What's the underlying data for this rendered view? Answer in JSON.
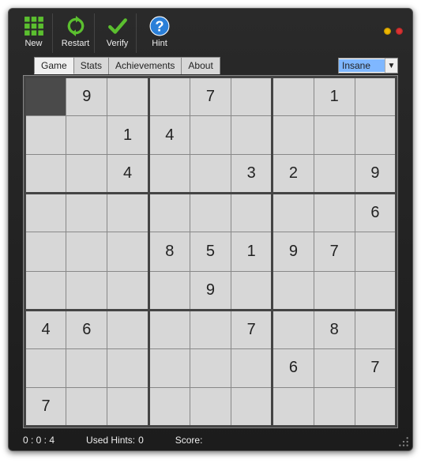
{
  "toolbar": {
    "new_label": "New",
    "restart_label": "Restart",
    "verify_label": "Verify",
    "hint_label": "Hint"
  },
  "tabs": {
    "game": "Game",
    "stats": "Stats",
    "achievements": "Achievements",
    "about": "About"
  },
  "difficulty": {
    "selected": "Insane"
  },
  "sudoku": {
    "selected": [
      0,
      0
    ],
    "grid": [
      [
        "",
        "9",
        "",
        "",
        "7",
        "",
        "",
        "1",
        ""
      ],
      [
        "",
        "",
        "1",
        "4",
        "",
        "",
        "",
        "",
        ""
      ],
      [
        "",
        "",
        "4",
        "",
        "",
        "3",
        "2",
        "",
        "9"
      ],
      [
        "",
        "",
        "",
        "",
        "",
        "",
        "",
        "",
        "6"
      ],
      [
        "",
        "",
        "",
        "8",
        "5",
        "1",
        "9",
        "7",
        ""
      ],
      [
        "",
        "",
        "",
        "",
        "9",
        "",
        "",
        "",
        ""
      ],
      [
        "4",
        "6",
        "",
        "",
        "",
        "7",
        "",
        "8",
        ""
      ],
      [
        "",
        "",
        "",
        "",
        "",
        "",
        "6",
        "",
        "7"
      ],
      [
        "7",
        "",
        "",
        "",
        "",
        "",
        "",
        "",
        ""
      ]
    ]
  },
  "status": {
    "time": "0 : 0 : 4",
    "hints_label": "Used Hints:",
    "hints_value": "0",
    "score_label": "Score:",
    "score_value": ""
  }
}
